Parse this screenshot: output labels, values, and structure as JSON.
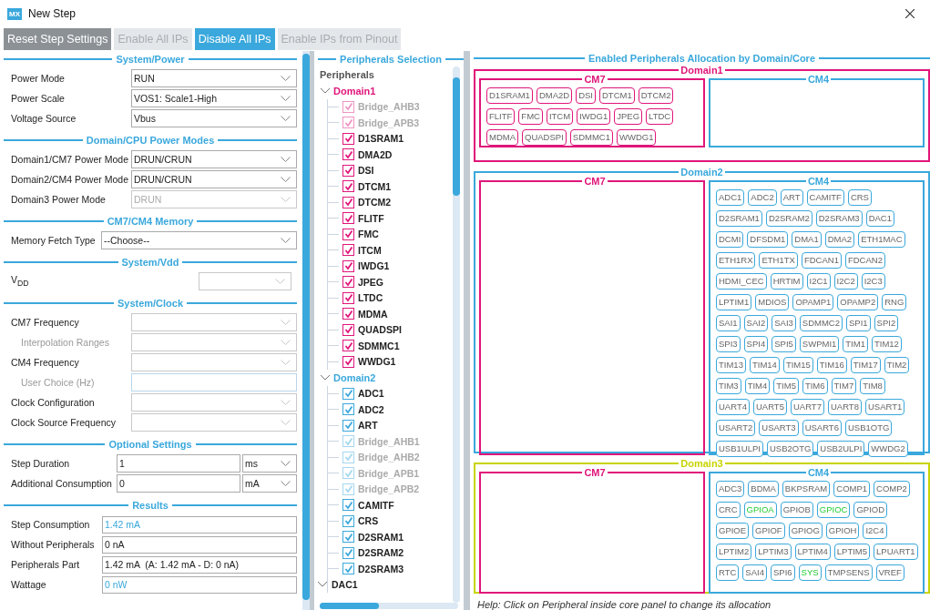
{
  "window": {
    "title": "New Step",
    "logo": "MX"
  },
  "toolbar": [
    {
      "label": "Reset Step Settings",
      "kind": "secondary",
      "disabled": false
    },
    {
      "label": "Enable All IPs",
      "kind": "plain",
      "disabled": true
    },
    {
      "label": "Disable All IPs",
      "kind": "primary",
      "disabled": false
    },
    {
      "label": "Enable IPs from Pinout",
      "kind": "plain",
      "disabled": true
    }
  ],
  "settings": [
    {
      "title": "System/Power",
      "rows": [
        {
          "label": "Power Mode",
          "kind": "select",
          "value": "RUN",
          "disabled": false
        },
        {
          "label": "Power Scale",
          "kind": "select",
          "value": "VOS1: Scale1-High",
          "disabled": false
        },
        {
          "label": "Voltage Source",
          "kind": "select",
          "value": "Vbus",
          "disabled": false
        }
      ]
    },
    {
      "title": "Domain/CPU Power Modes",
      "rows": [
        {
          "label": "Domain1/CM7 Power Mode",
          "kind": "select",
          "value": "DRUN/CRUN",
          "disabled": false
        },
        {
          "label": "Domain2/CM4 Power Mode",
          "kind": "select",
          "value": "DRUN/CRUN",
          "disabled": false
        },
        {
          "label": "Domain3 Power Mode",
          "kind": "select",
          "value": "DRUN",
          "disabled": true
        }
      ]
    },
    {
      "title": "CM7/CM4 Memory",
      "rows": [
        {
          "label": "Memory Fetch Type",
          "kind": "select",
          "value": "--Choose--",
          "disabled": false
        }
      ]
    },
    {
      "title": "System/Vdd",
      "rows": [
        {
          "label": "V$_{DD}$",
          "kind": "select",
          "disabled": true
        }
      ]
    },
    {
      "title": "System/Clock",
      "rows": [
        {
          "label": "CM7 Frequency",
          "kind": "select",
          "disabled": true,
          "children": [
            {
              "label": "Interpolation Ranges",
              "kind": "select",
              "disabled": true
            }
          ]
        },
        {
          "label": "CM4 Frequency",
          "kind": "select",
          "disabled": true,
          "children": [
            {
              "label": "User Choice (Hz)",
              "kind": "input",
              "disabled": true
            }
          ]
        },
        {
          "label": "Clock Configuration",
          "kind": "select",
          "disabled": true
        },
        {
          "label": "Clock Source Frequency",
          "kind": "select",
          "disabled": true
        }
      ]
    },
    {
      "title": "Optional Settings",
      "rows": [
        {
          "label": "Step Duration",
          "kind": "input-unit",
          "value": "1",
          "unit": "ms",
          "disabled": false
        },
        {
          "label": "Additional Consumption",
          "kind": "input-unit",
          "value": "0",
          "unit": "mA",
          "disabled": false
        }
      ]
    },
    {
      "title": "Results",
      "rows": [
        {
          "label": "Step Consumption",
          "kind": "output",
          "value": "1.42 mA",
          "highlight": true
        },
        {
          "label": "Without Peripherals",
          "kind": "output",
          "value": "0 nA",
          "highlight": false
        },
        {
          "label": "Peripherals Part",
          "kind": "output",
          "value": "1.42 mA  (A: 1.42 mA - D: 0 nA)",
          "highlight": false
        },
        {
          "label": "Wattage",
          "kind": "output",
          "value": "0 nW",
          "highlight": true
        }
      ]
    }
  ],
  "peripherals_selection": {
    "title": "Peripherals Selection",
    "root": "Peripherals",
    "children": [
      {
        "label": "Domain1",
        "color": "#e0157a",
        "expanded": true,
        "children": [
          {
            "label": "Bridge_AHB3",
            "checked": true,
            "disabled": true
          },
          {
            "label": "Bridge_APB3",
            "checked": true,
            "disabled": true
          },
          {
            "label": "D1SRAM1",
            "checked": true,
            "disabled": false
          },
          {
            "label": "DMA2D",
            "checked": true,
            "disabled": false
          },
          {
            "label": "DSI",
            "checked": true,
            "disabled": false
          },
          {
            "label": "DTCM1",
            "checked": true,
            "disabled": false
          },
          {
            "label": "DTCM2",
            "checked": true,
            "disabled": false
          },
          {
            "label": "FLITF",
            "checked": true,
            "disabled": false
          },
          {
            "label": "FMC",
            "checked": true,
            "disabled": false
          },
          {
            "label": "ITCM",
            "checked": true,
            "disabled": false
          },
          {
            "label": "IWDG1",
            "checked": true,
            "disabled": false
          },
          {
            "label": "JPEG",
            "checked": true,
            "disabled": false
          },
          {
            "label": "LTDC",
            "checked": true,
            "disabled": false
          },
          {
            "label": "MDMA",
            "checked": true,
            "disabled": false
          },
          {
            "label": "QUADSPI",
            "checked": true,
            "disabled": false
          },
          {
            "label": "SDMMC1",
            "checked": true,
            "disabled": false
          },
          {
            "label": "WWDG1",
            "checked": true,
            "disabled": false
          }
        ]
      },
      {
        "label": "Domain2",
        "color": "#3aa8dc",
        "expanded": true,
        "children": [
          {
            "label": "ADC1",
            "checked": true,
            "disabled": false
          },
          {
            "label": "ADC2",
            "checked": true,
            "disabled": false
          },
          {
            "label": "ART",
            "checked": true,
            "disabled": false
          },
          {
            "label": "Bridge_AHB1",
            "checked": true,
            "disabled": true
          },
          {
            "label": "Bridge_AHB2",
            "checked": true,
            "disabled": true
          },
          {
            "label": "Bridge_APB1",
            "checked": true,
            "disabled": true
          },
          {
            "label": "Bridge_APB2",
            "checked": true,
            "disabled": true
          },
          {
            "label": "CAMITF",
            "checked": true,
            "disabled": false
          },
          {
            "label": "CRS",
            "checked": true,
            "disabled": false
          },
          {
            "label": "D2SRAM1",
            "checked": true,
            "disabled": false
          },
          {
            "label": "D2SRAM2",
            "checked": true,
            "disabled": false
          },
          {
            "label": "D2SRAM3",
            "checked": true,
            "disabled": false
          },
          {
            "label": "DAC1",
            "kind": "group",
            "expanded": true
          }
        ]
      }
    ]
  },
  "allocation": {
    "title": "Enabled Peripherals Allocation by Domain/Core",
    "domains": [
      {
        "name": "Domain1",
        "color": "#e0157a",
        "cores": [
          {
            "name": "CM7",
            "color": "#e0157a",
            "peripherals": [
              {
                "label": "D1SRAM1"
              },
              {
                "label": "DMA2D"
              },
              {
                "label": "DSI"
              },
              {
                "label": "DTCM1"
              },
              {
                "label": "DTCM2"
              },
              {
                "label": "FLITF"
              },
              {
                "label": "FMC"
              },
              {
                "label": "ITCM"
              },
              {
                "label": "IWDG1"
              },
              {
                "label": "JPEG"
              },
              {
                "label": "LTDC"
              },
              {
                "label": "MDMA"
              },
              {
                "label": "QUADSPI"
              },
              {
                "label": "SDMMC1"
              },
              {
                "label": "WWDG1"
              }
            ]
          },
          {
            "name": "CM4",
            "color": "#3aa8dc"
          }
        ]
      },
      {
        "name": "Domain2",
        "color": "#3aa8dc",
        "cores": [
          {
            "name": "CM7",
            "color": "#e0157a"
          },
          {
            "name": "CM4",
            "color": "#3aa8dc",
            "peripherals": [
              {
                "label": "ADC1"
              },
              {
                "label": "ADC2"
              },
              {
                "label": "ART"
              },
              {
                "label": "CAMITF"
              },
              {
                "label": "CRS"
              },
              {
                "label": "D2SRAM1"
              },
              {
                "label": "D2SRAM2"
              },
              {
                "label": "D2SRAM3"
              },
              {
                "label": "DAC1"
              },
              {
                "label": "DCMI"
              },
              {
                "label": "DFSDM1"
              },
              {
                "label": "DMA1"
              },
              {
                "label": "DMA2"
              },
              {
                "label": "ETH1MAC"
              },
              {
                "label": "ETH1RX"
              },
              {
                "label": "ETH1TX"
              },
              {
                "label": "FDCAN1"
              },
              {
                "label": "FDCAN2"
              },
              {
                "label": "HDMI_CEC"
              },
              {
                "label": "HRTIM"
              },
              {
                "label": "I2C1"
              },
              {
                "label": "I2C2"
              },
              {
                "label": "I2C3"
              },
              {
                "label": "LPTIM1"
              },
              {
                "label": "MDIOS"
              },
              {
                "label": "OPAMP1"
              },
              {
                "label": "OPAMP2"
              },
              {
                "label": "RNG"
              },
              {
                "label": "SAI1"
              },
              {
                "label": "SAI2"
              },
              {
                "label": "SAI3"
              },
              {
                "label": "SDMMC2"
              },
              {
                "label": "SPI1"
              },
              {
                "label": "SPI2"
              },
              {
                "label": "SPI3"
              },
              {
                "label": "SPI4"
              },
              {
                "label": "SPI5"
              },
              {
                "label": "SWPMI1"
              },
              {
                "label": "TIM1"
              },
              {
                "label": "TIM12"
              },
              {
                "label": "TIM13"
              },
              {
                "label": "TIM14"
              },
              {
                "label": "TIM15"
              },
              {
                "label": "TIM16"
              },
              {
                "label": "TIM17"
              },
              {
                "label": "TIM2"
              },
              {
                "label": "TIM3"
              },
              {
                "label": "TIM4"
              },
              {
                "label": "TIM5"
              },
              {
                "label": "TIM6"
              },
              {
                "label": "TIM7"
              },
              {
                "label": "TIM8"
              },
              {
                "label": "UART4"
              },
              {
                "label": "UART5"
              },
              {
                "label": "UART7"
              },
              {
                "label": "UART8"
              },
              {
                "label": "USART1"
              },
              {
                "label": "USART2"
              },
              {
                "label": "USART3"
              },
              {
                "label": "USART6"
              },
              {
                "label": "USB1OTG"
              },
              {
                "label": "USB1ULPI"
              },
              {
                "label": "USB2OTG"
              },
              {
                "label": "USB2ULPI"
              },
              {
                "label": "WWDG2"
              }
            ]
          }
        ]
      },
      {
        "name": "Domain3",
        "color": "#c8d400",
        "cores": [
          {
            "name": "CM7",
            "color": "#e0157a"
          },
          {
            "name": "CM4",
            "color": "#3aa8dc",
            "peripherals": [
              {
                "label": "ADC3",
                "used": false
              },
              {
                "label": "BDMA",
                "used": false
              },
              {
                "label": "BKPSRAM",
                "used": false
              },
              {
                "label": "COMP1",
                "used": false
              },
              {
                "label": "COMP2",
                "used": false
              },
              {
                "label": "CRC",
                "used": false
              },
              {
                "label": "GPIOA",
                "used": true
              },
              {
                "label": "GPIOB",
                "used": false
              },
              {
                "label": "GPIOC",
                "used": true
              },
              {
                "label": "GPIOD",
                "used": false
              },
              {
                "label": "GPIOE",
                "used": false
              },
              {
                "label": "GPIOF",
                "used": false
              },
              {
                "label": "GPIOG",
                "used": false
              },
              {
                "label": "GPIOH",
                "used": false
              },
              {
                "label": "I2C4",
                "used": false
              },
              {
                "label": "LPTIM2",
                "used": false
              },
              {
                "label": "LPTIM3",
                "used": false
              },
              {
                "label": "LPTIM4",
                "used": false
              },
              {
                "label": "LPTIM5",
                "used": false
              },
              {
                "label": "LPUART1",
                "used": false
              },
              {
                "label": "RTC",
                "used": false
              },
              {
                "label": "SAI4",
                "used": false
              },
              {
                "label": "SPI6",
                "used": false
              },
              {
                "label": "SYS",
                "used": true
              },
              {
                "label": "TMPSENS",
                "used": false
              },
              {
                "label": "VREF",
                "used": false
              }
            ]
          }
        ]
      }
    ],
    "help": "Help: Click on Peripheral inside core panel to change its allocation"
  }
}
